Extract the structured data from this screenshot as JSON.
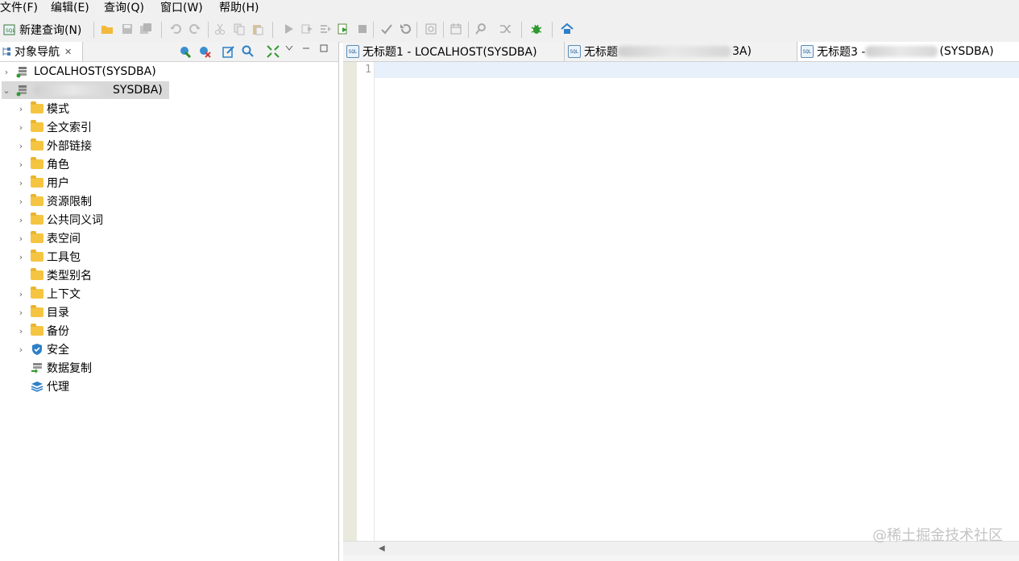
{
  "menu": {
    "items": [
      "文件(F)",
      "编辑(E)",
      "查询(Q)",
      "窗口(W)",
      "帮助(H)"
    ]
  },
  "toolbar": {
    "new_query_label": "新建查询(N)"
  },
  "navigator": {
    "tab_label": "对象导航",
    "close_glyph": "✕",
    "connections": [
      {
        "label": "LOCALHOST(SYSDBA)"
      },
      {
        "label": "SYSDBA)"
      }
    ],
    "tree_items": [
      {
        "label": "模式",
        "icon": "folder-icon"
      },
      {
        "label": "全文索引",
        "icon": "folder-icon"
      },
      {
        "label": "外部链接",
        "icon": "folder-icon"
      },
      {
        "label": "角色",
        "icon": "folder-icon"
      },
      {
        "label": "用户",
        "icon": "folder-icon"
      },
      {
        "label": "资源限制",
        "icon": "folder-icon"
      },
      {
        "label": "公共同义词",
        "icon": "folder-icon"
      },
      {
        "label": "表空间",
        "icon": "folder-icon"
      },
      {
        "label": "工具包",
        "icon": "folder-icon"
      },
      {
        "label": "类型别名",
        "icon": "folder-icon"
      },
      {
        "label": "上下文",
        "icon": "folder-icon"
      },
      {
        "label": "目录",
        "icon": "folder-icon"
      },
      {
        "label": "备份",
        "icon": "folder-icon"
      },
      {
        "label": "安全",
        "icon": "shield-icon"
      },
      {
        "label": "数据复制",
        "icon": "replication-icon"
      },
      {
        "label": "代理",
        "icon": "layers-icon"
      }
    ]
  },
  "editor": {
    "tabs": [
      {
        "label": "无标题1 - LOCALHOST(SYSDBA)"
      },
      {
        "label": "无标题",
        "suffix": "3A)"
      },
      {
        "label": "无标题3 -",
        "suffix": "(SYSDBA)"
      }
    ],
    "line_number": "1"
  },
  "watermark": "@稀土掘金技术社区",
  "colors": {
    "folder": "#f5c542",
    "toolbar_bg": "#f0f0f0",
    "current_line": "#e8f1fb",
    "gutter": "#e9e9dd"
  }
}
